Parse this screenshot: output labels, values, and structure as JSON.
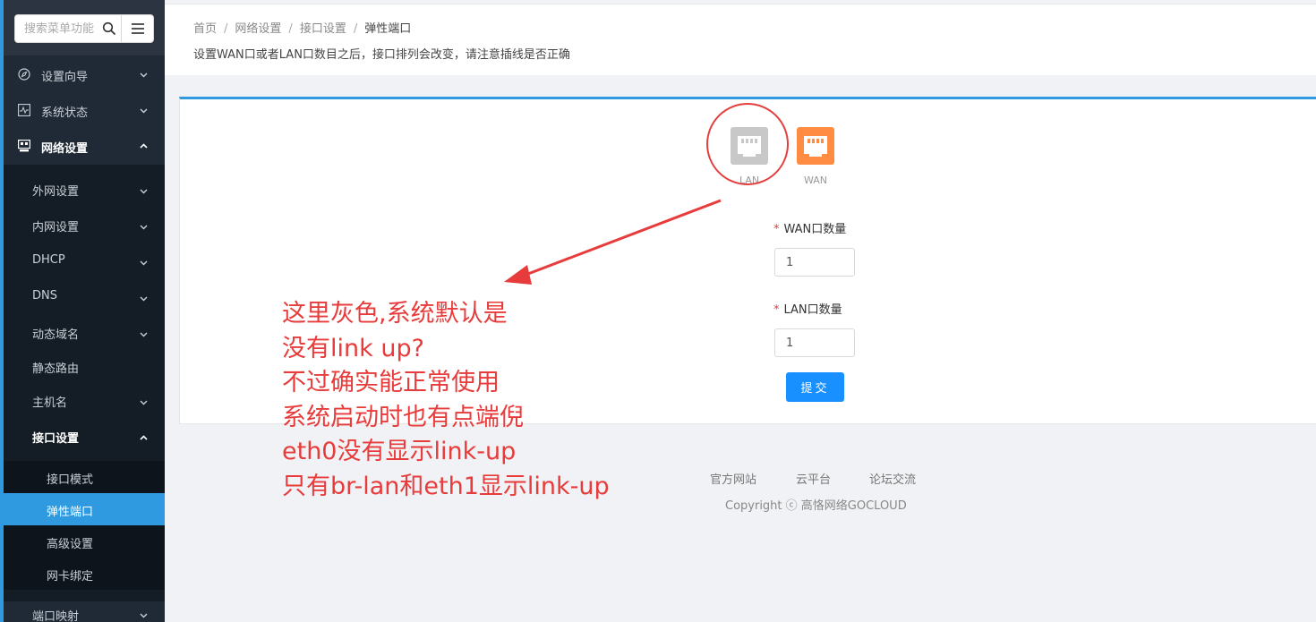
{
  "sidebar": {
    "search_placeholder": "搜索菜单功能",
    "items": [
      {
        "label": "设置向导",
        "icon": "compass-icon"
      },
      {
        "label": "系统状态",
        "icon": "pulse-chart-icon"
      },
      {
        "label": "网络设置",
        "icon": "network-icon"
      }
    ],
    "network_sub": [
      {
        "label": "外网设置"
      },
      {
        "label": "内网设置"
      },
      {
        "label": "DHCP"
      },
      {
        "label": "DNS"
      },
      {
        "label": "动态域名"
      },
      {
        "label": "静态路由"
      },
      {
        "label": "主机名"
      },
      {
        "label": "接口设置"
      }
    ],
    "interface_sub": [
      {
        "label": "接口模式"
      },
      {
        "label": "弹性端口"
      },
      {
        "label": "高级设置"
      },
      {
        "label": "网卡绑定"
      }
    ],
    "port_mapping": "端口映射"
  },
  "breadcrumb": {
    "home": "首页",
    "network": "网络设置",
    "interface": "接口设置",
    "current": "弹性端口"
  },
  "page_description": "设置WAN口或者LAN口数目之后，接口排列会改变，请注意插线是否正确",
  "ports": {
    "lan_label": "LAN",
    "wan_label": "WAN",
    "colors": {
      "lan": "#c8c8c8",
      "wan": "#ff8c42"
    }
  },
  "form": {
    "wan_count_label": "WAN口数量",
    "wan_count_value": "1",
    "lan_count_label": "LAN口数量",
    "lan_count_value": "1",
    "required_mark": "*",
    "submit_label": "提交"
  },
  "footer": {
    "links": [
      "官方网站",
      "云平台",
      "论坛交流"
    ],
    "copyright": "Copyright ⓒ 高恪网络GOCLOUD"
  },
  "annotation": {
    "lines": [
      "这里灰色,系统默认是",
      "没有link up?",
      "不过确实能正常使用",
      "系统启动时也有点端倪",
      "eth0没有显示link-up",
      "只有br-lan和eth1显示link-up"
    ],
    "color": "#e83b3b"
  },
  "accent_color": "#2f9ae0"
}
